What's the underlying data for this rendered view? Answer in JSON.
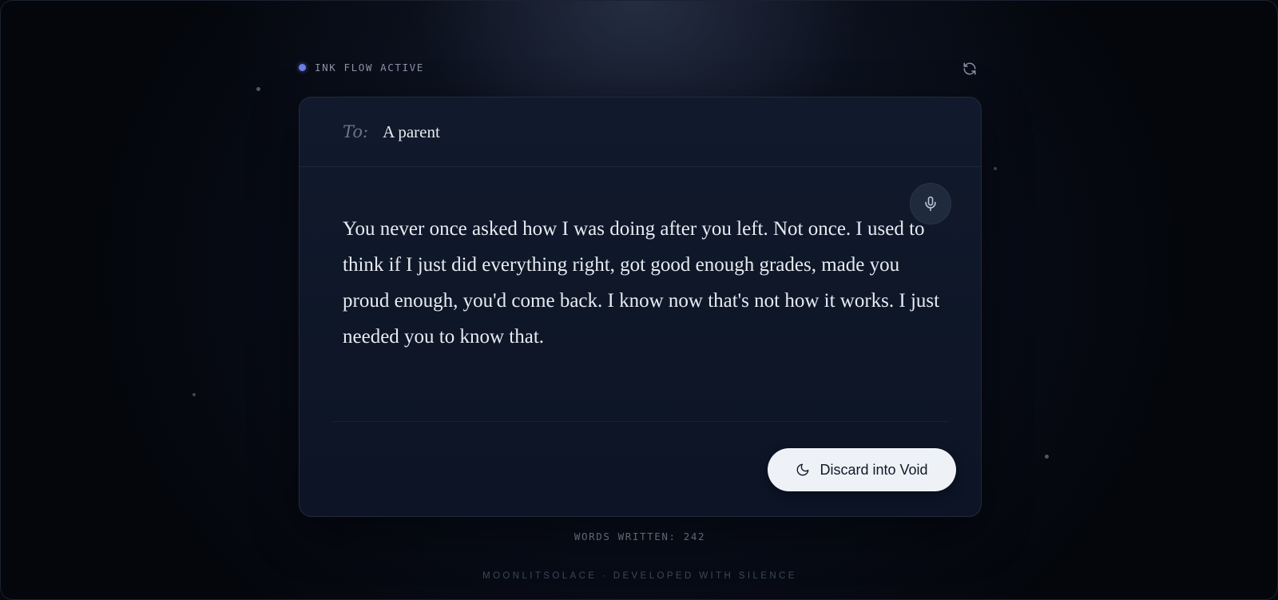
{
  "status": {
    "label": "INK FLOW ACTIVE",
    "dot_color": "#6f7de8"
  },
  "icons": {
    "refresh": "refresh-icon",
    "microphone": "microphone-icon",
    "moon": "moon-icon"
  },
  "letter": {
    "to_label": "To:",
    "recipient": "A parent",
    "body": "You never once asked how I was doing after you left. Not once. I used to think if I just did everything right, got good enough grades, made you proud enough, you'd come back. I know now that's not how it works. I just needed you to know that."
  },
  "actions": {
    "discard_label": "Discard into Void"
  },
  "stats": {
    "words_written": "WORDS WRITTEN: 242"
  },
  "footer": {
    "text": "MOONLITSOLACE · DEVELOPED WITH SILENCE"
  },
  "colors": {
    "background": "#05080f",
    "card": "#0f1729",
    "accent": "#6f7de8",
    "button": "#eef2f7"
  }
}
